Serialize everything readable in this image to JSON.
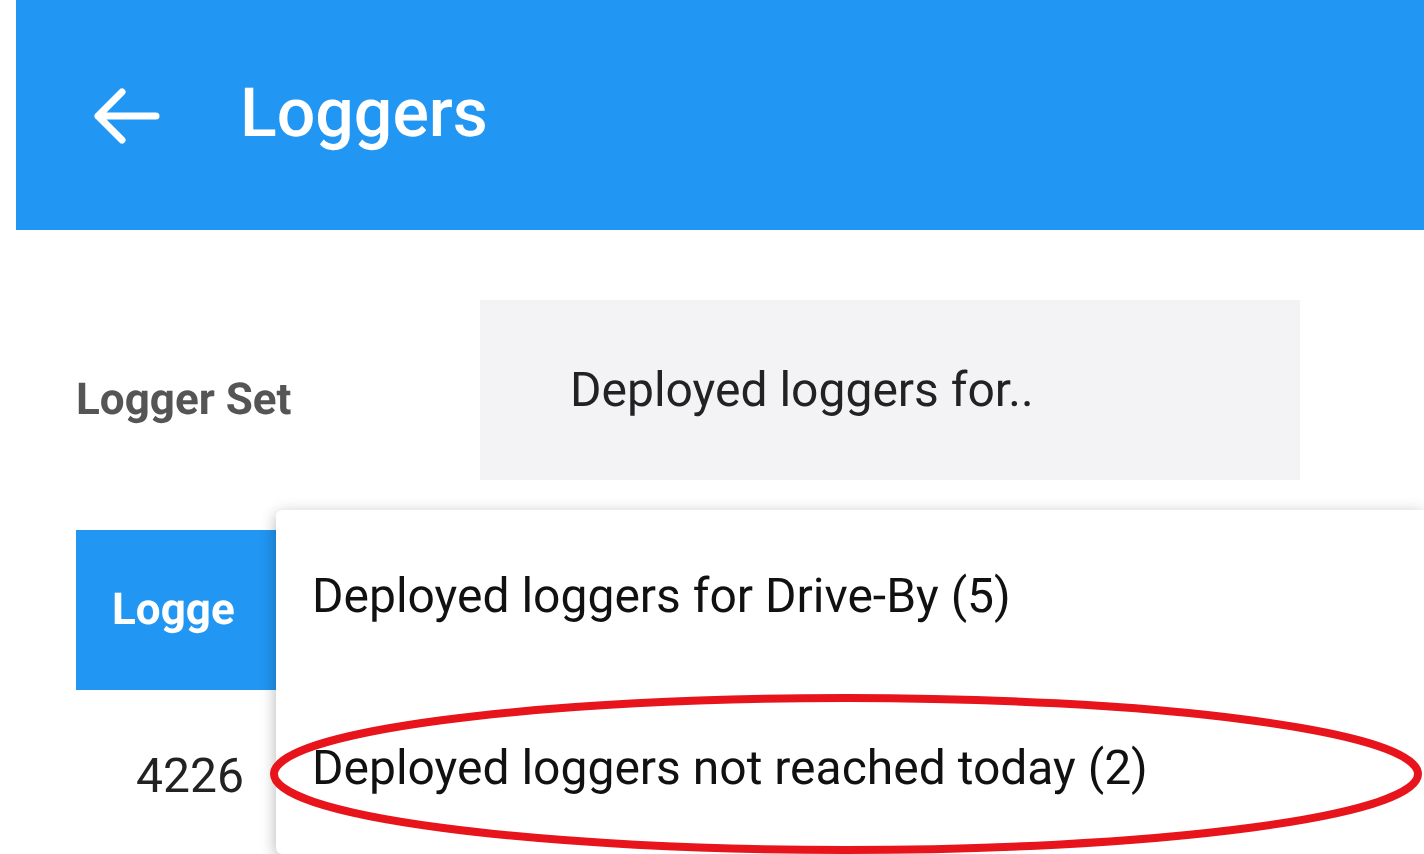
{
  "app_bar": {
    "title": "Loggers"
  },
  "logger_set": {
    "label": "Logger Set",
    "value": "Deployed loggers for.."
  },
  "button": {
    "label": "Logge"
  },
  "row_text": "4226",
  "menu": {
    "items": [
      {
        "label": "Deployed loggers for Drive-By (5)",
        "highlighted": false
      },
      {
        "label": "Deployed loggers not reached today (2)",
        "highlighted": true
      }
    ]
  }
}
